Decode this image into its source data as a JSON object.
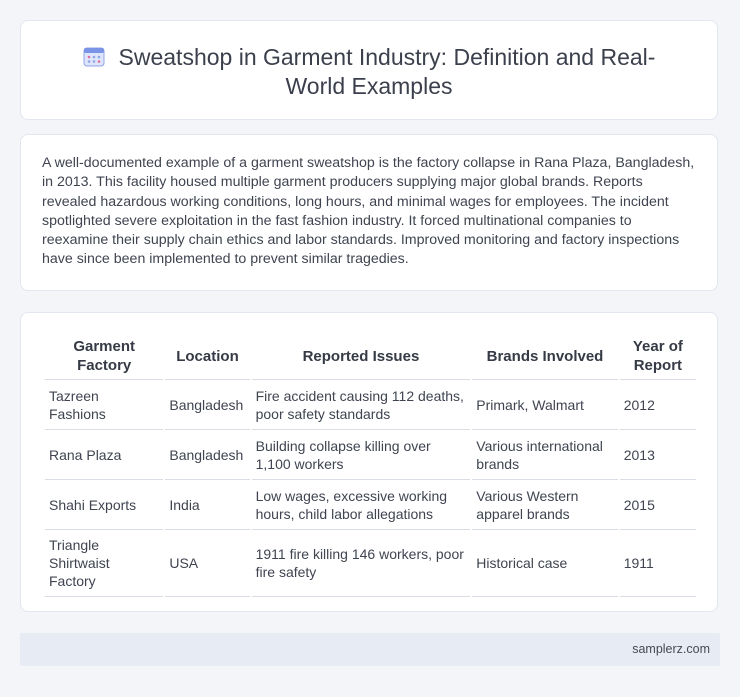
{
  "header": {
    "icon": "calendar-icon",
    "title": "Sweatshop in Garment Industry: Definition and Real-World Examples"
  },
  "intro": {
    "text": "A well-documented example of a garment sweatshop is the factory collapse in Rana Plaza, Bangladesh, in 2013. This facility housed multiple garment producers supplying major global brands. Reports revealed hazardous working conditions, long hours, and minimal wages for employees. The incident spotlighted severe exploitation in the fast fashion industry. It forced multinational companies to reexamine their supply chain ethics and labor standards. Improved monitoring and factory inspections have since been implemented to prevent similar tragedies."
  },
  "table": {
    "headers": [
      "Garment Factory",
      "Location",
      "Reported Issues",
      "Brands Involved",
      "Year of Report"
    ],
    "rows": [
      [
        "Tazreen Fashions",
        "Bangladesh",
        "Fire accident causing 112 deaths, poor safety standards",
        "Primark, Walmart",
        "2012"
      ],
      [
        "Rana Plaza",
        "Bangladesh",
        "Building collapse killing over 1,100 workers",
        "Various international brands",
        "2013"
      ],
      [
        "Shahi Exports",
        "India",
        "Low wages, excessive working hours, child labor allegations",
        "Various Western apparel brands",
        "2015"
      ],
      [
        "Triangle Shirtwaist Factory",
        "USA",
        "1911 fire killing 146 workers, poor fire safety",
        "Historical case",
        "1911"
      ]
    ]
  },
  "footer": {
    "site": "samplerz.com"
  }
}
